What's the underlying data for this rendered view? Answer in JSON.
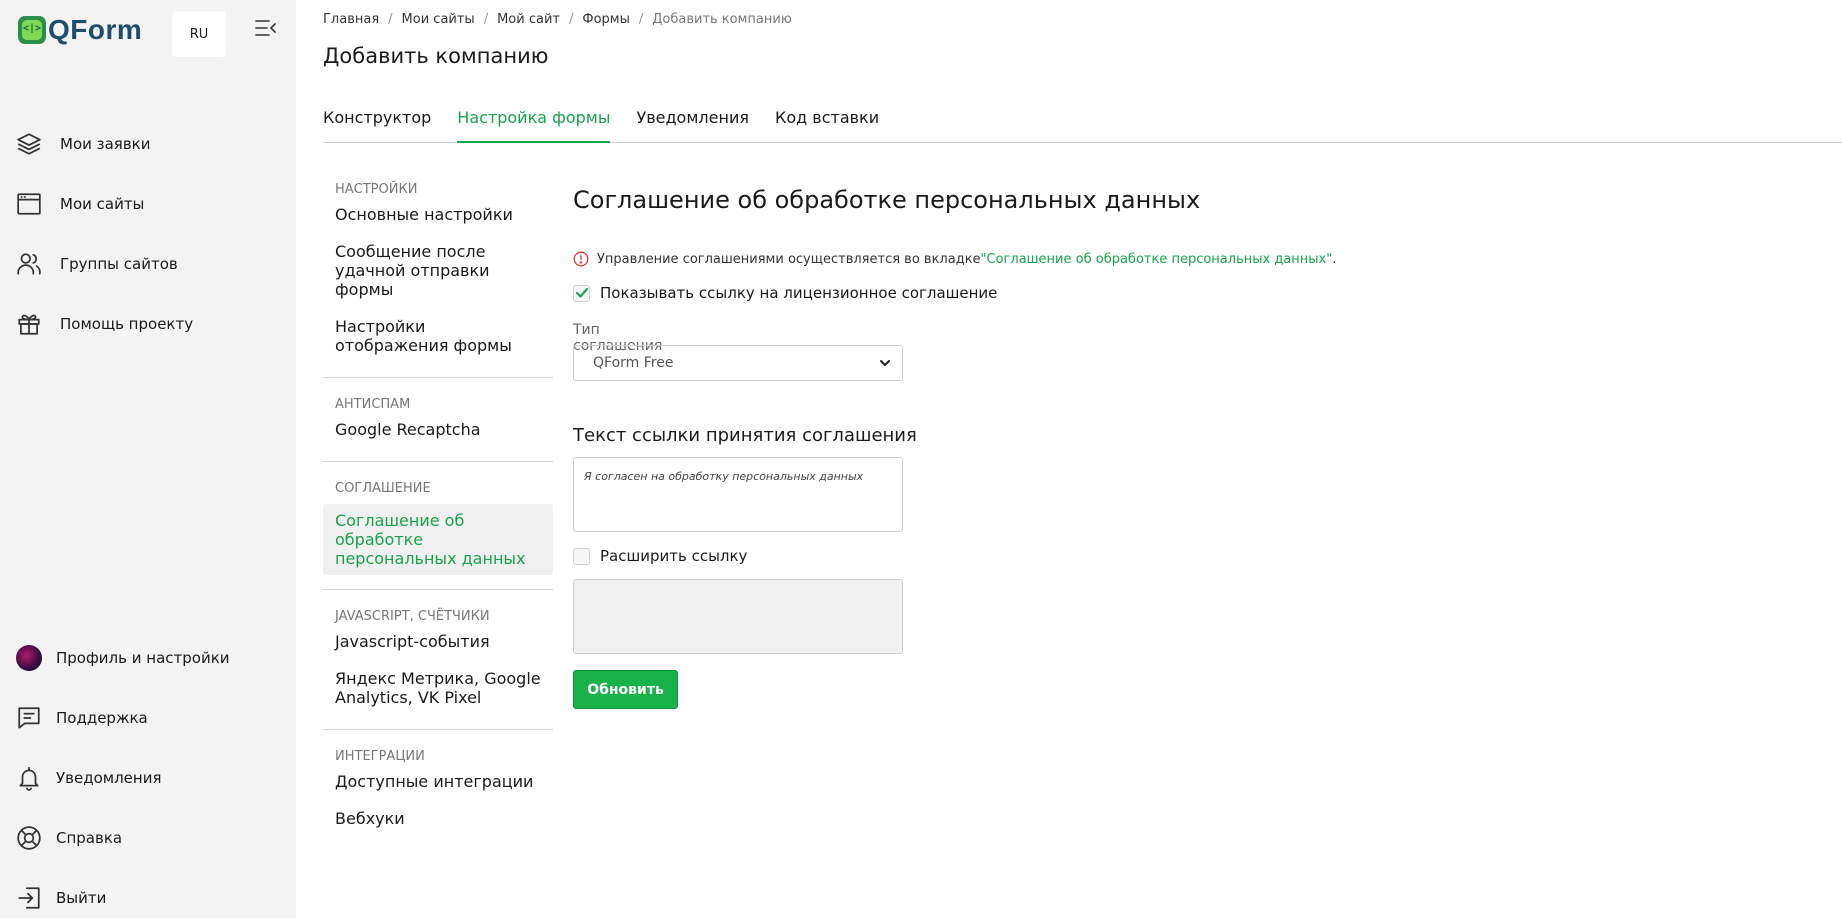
{
  "app": {
    "logo_text": "QForm",
    "logo_mark": "<|>",
    "language": "RU"
  },
  "sidebar": {
    "top_items": [
      {
        "label": "Мои заявки",
        "icon": "layers-icon"
      },
      {
        "label": "Мои сайты",
        "icon": "browser-window-icon"
      },
      {
        "label": "Группы сайтов",
        "icon": "users-icon"
      },
      {
        "label": "Помощь проекту",
        "icon": "gift-icon"
      }
    ],
    "bottom_items": [
      {
        "label": "Профиль и настройки",
        "icon": "avatar"
      },
      {
        "label": "Поддержка",
        "icon": "chat-icon"
      },
      {
        "label": "Уведомления",
        "icon": "bell-icon"
      },
      {
        "label": "Справка",
        "icon": "lifebuoy-icon"
      },
      {
        "label": "Выйти",
        "icon": "logout-icon"
      }
    ]
  },
  "breadcrumb": [
    "Главная",
    "Мои сайты",
    "Мой сайт",
    "Формы",
    "Добавить компанию"
  ],
  "page_title": "Добавить компанию",
  "tabs": [
    {
      "label": "Конструктор",
      "active": false
    },
    {
      "label": "Настройка формы",
      "active": true
    },
    {
      "label": "Уведомления",
      "active": false
    },
    {
      "label": "Код вставки",
      "active": false
    }
  ],
  "settings_menu": {
    "sections": [
      {
        "title": "НАСТРОЙКИ",
        "items": [
          "Основные настройки",
          "Сообщение после удачной отправки формы",
          "Настройки отображения формы"
        ]
      },
      {
        "title": "АНТИСПАМ",
        "items": [
          "Google Recaptcha"
        ]
      },
      {
        "title": "СОГЛАШЕНИЕ",
        "items": [
          "Соглашение об обработке персональных данных"
        ]
      },
      {
        "title": "JAVASCRIPT, СЧЁТЧИКИ",
        "items": [
          "Javascript-события",
          "Яндекс Метрика, Google Analytics, VK Pixel"
        ]
      },
      {
        "title": "ИНТЕГРАЦИИ",
        "items": [
          "Доступные интеграции",
          "Вебхуки"
        ]
      }
    ]
  },
  "content": {
    "heading": "Соглашение об обработке персональных данных",
    "notice_prefix": "Управление соглашениями осуществляется во вкладке ",
    "notice_link": "\"Соглашение об обработке персональных данных\"",
    "notice_suffix": ".",
    "show_link_checkbox": {
      "label": "Показывать ссылку на лицензионное соглашение",
      "checked": true
    },
    "agreement_type_label": "Тип соглашения",
    "agreement_type_value": "QForm Free",
    "link_text_heading": "Текст ссылки принятия соглашения",
    "link_text_value": "Я согласен на обработку персональных данных",
    "extend_link_checkbox": {
      "label": "Расширить ссылку",
      "checked": false
    },
    "extended_text_value": "",
    "update_button": "Обновить"
  },
  "colors": {
    "accent": "#17a34a",
    "button": "#17b24a",
    "sidebar_bg": "#f3f3f3",
    "notice_icon": "#e53935"
  }
}
